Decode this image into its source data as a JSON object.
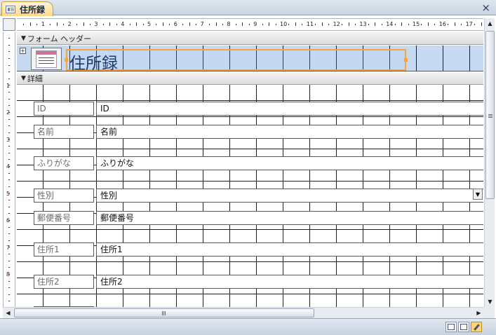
{
  "tab": {
    "label": "住所録",
    "close_label": "×"
  },
  "ruler": {
    "h_numbers": [
      "1",
      "2",
      "3",
      "4",
      "5",
      "6",
      "7",
      "8",
      "9",
      "10",
      "11",
      "12",
      "13",
      "14",
      "15",
      "16",
      "17"
    ],
    "v_numbers": [
      "1",
      "2",
      "3",
      "4",
      "5",
      "6",
      "7",
      "8"
    ]
  },
  "sections": {
    "form_header": "フォーム ヘッダー",
    "detail": "詳細"
  },
  "header": {
    "title": "住所録"
  },
  "fields": [
    {
      "label": "ID",
      "control": "ID"
    },
    {
      "label": "名前",
      "control": "名前"
    },
    {
      "label": "ふりがな",
      "control": "ふりがな"
    },
    {
      "label": "性別",
      "control": "性別"
    },
    {
      "label": "郵便番号",
      "control": "郵便番号"
    },
    {
      "label": "住所1",
      "control": "住所1"
    },
    {
      "label": "住所2",
      "control": "住所2"
    }
  ],
  "statusbar": {
    "views": [
      "form-view-icon",
      "layout-view-icon",
      "design-view-icon"
    ],
    "active_view": "design-view-icon"
  },
  "colors": {
    "header_background": "#c5d9f1",
    "selection_border": "#f5a33a",
    "title_text": "#1f3a67"
  }
}
